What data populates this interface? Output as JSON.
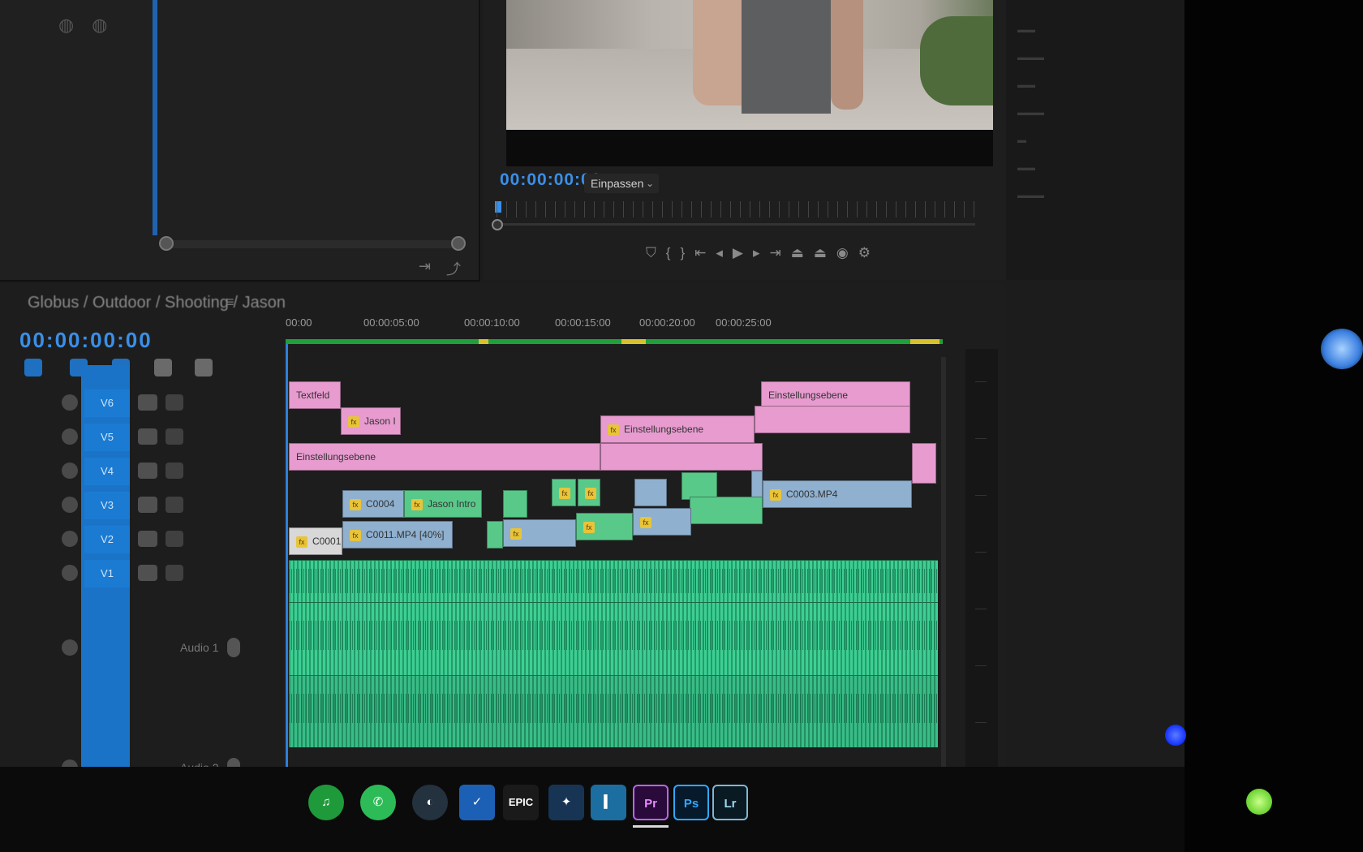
{
  "program_monitor": {
    "timecode": "00:00:00:00",
    "zoom_select": "Einpassen"
  },
  "timeline": {
    "sequence_name": "Globus / Outdoor / Shooting / Jason",
    "timecode": "00:00:00:00",
    "ruler_labels": [
      "00:00",
      "00:00:05:00",
      "00:00:10:00",
      "00:00:15:00",
      "00:00:20:00",
      "00:00:25:00"
    ],
    "video_tracks": [
      "V6",
      "V5",
      "V4",
      "V3",
      "V2",
      "V1"
    ],
    "audio_tracks": [
      "Audio 1",
      "Audio 2"
    ],
    "clips": {
      "v6_title": "Textfeld",
      "v5_jason": "Jason I",
      "v4_adj_a": "Einstellungsebene",
      "v5_adj_b": "Einstellungsebene",
      "v6_adj_c": "Einstellungsebene",
      "v2_c0004": "C0004",
      "v2_jason_intro": "Jason Intro",
      "v1_c0001": "C0001",
      "v1_c0011": "C0011.MP4 [40%]",
      "v2_late": "C0003.MP4"
    }
  },
  "taskbar": {
    "epic_label": "EPIC",
    "pr_label": "Pr",
    "ps_label": "Ps",
    "lr_label": "Lr"
  },
  "colors": {
    "accent_blue": "#3a8fe8",
    "clip_pink": "#e79bcf",
    "clip_green": "#59c98a",
    "audio_green": "#3dcf93",
    "work_area_green": "#1fa03a"
  }
}
